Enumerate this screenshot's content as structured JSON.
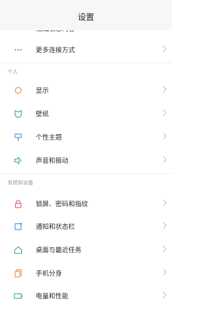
{
  "header": {
    "title": "设置"
  },
  "clipped_item": {
    "label": "隐藏敏感内容"
  },
  "top_group": {
    "label": "更多连接方式"
  },
  "section_personal": "个人",
  "personal_items": [
    {
      "label": "显示",
      "icon": "sun-icon"
    },
    {
      "label": "壁纸",
      "icon": "shield-icon"
    },
    {
      "label": "个性主题",
      "icon": "brush-icon"
    },
    {
      "label": "声音和振动",
      "icon": "speaker-icon"
    }
  ],
  "section_system": "系统和设备",
  "system_items": [
    {
      "label": "锁屏、密码和指纹",
      "icon": "lock-icon"
    },
    {
      "label": "通知和状态栏",
      "icon": "notification-icon"
    },
    {
      "label": "桌面与最近任务",
      "icon": "home-icon"
    },
    {
      "label": "手机分身",
      "icon": "clone-icon"
    },
    {
      "label": "电量和性能",
      "icon": "battery-icon"
    }
  ],
  "colors": {
    "accent": "#f08a3c",
    "icon_blue": "#4a90e2",
    "chevron": "#c7c7c7"
  }
}
